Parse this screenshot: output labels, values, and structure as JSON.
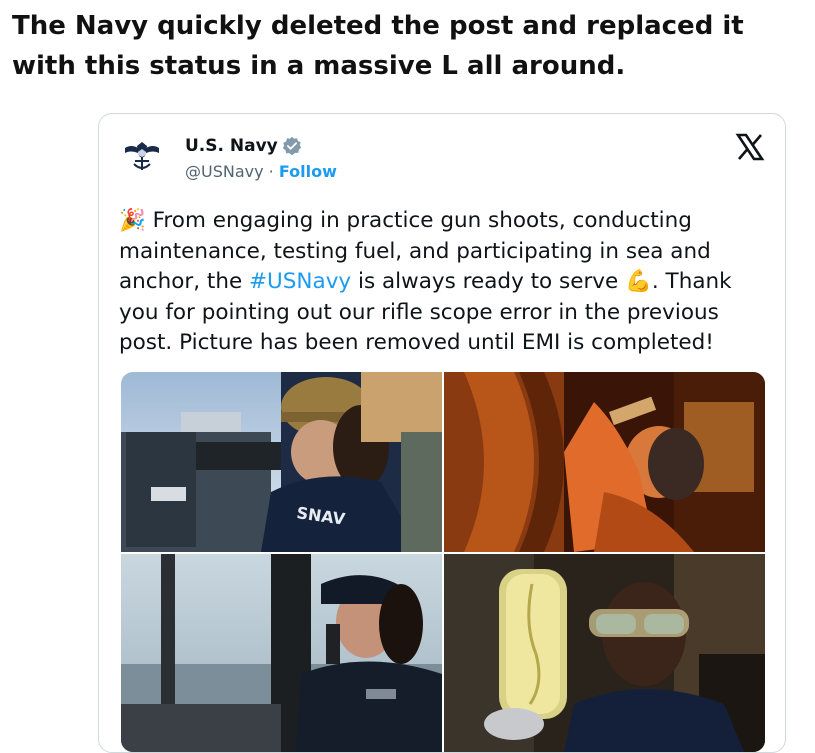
{
  "headline": "The Navy quickly deleted the post and replaced it with this status in a massive L all around.",
  "tweet": {
    "author_name": "U.S. Navy",
    "handle": "@USNavy",
    "separator": " · ",
    "follow_label": "Follow",
    "text_part1": " From engaging in practice gun shoots, conducting maintenance, testing fuel, and participating in sea and anchor, the ",
    "hashtag": "#USNavy",
    "text_part2": " is always ready to serve ",
    "text_part3": ". Thank you for pointing out our rifle scope error in the previous post. Picture has been removed until EMI is completed!",
    "emoji_start": "🎉",
    "emoji_mid": "💪",
    "photo_shirt_text": "SNAV"
  },
  "icons": {
    "avatar": "navy-eagle-anchor-logo",
    "verified": "verified-badge-icon",
    "platform": "x-logo-icon"
  },
  "colors": {
    "link": "#1d9bf0",
    "secondary_text": "#536471",
    "border": "#cfd9de"
  },
  "media": {
    "count": 4,
    "photos": [
      "sailor-in-helmet-aiming-mounted-gun",
      "sailor-with-headset-doing-maintenance",
      "sailor-on-bridge-using-radio",
      "sailor-in-goggles-inspecting-fuel-sample"
    ]
  }
}
